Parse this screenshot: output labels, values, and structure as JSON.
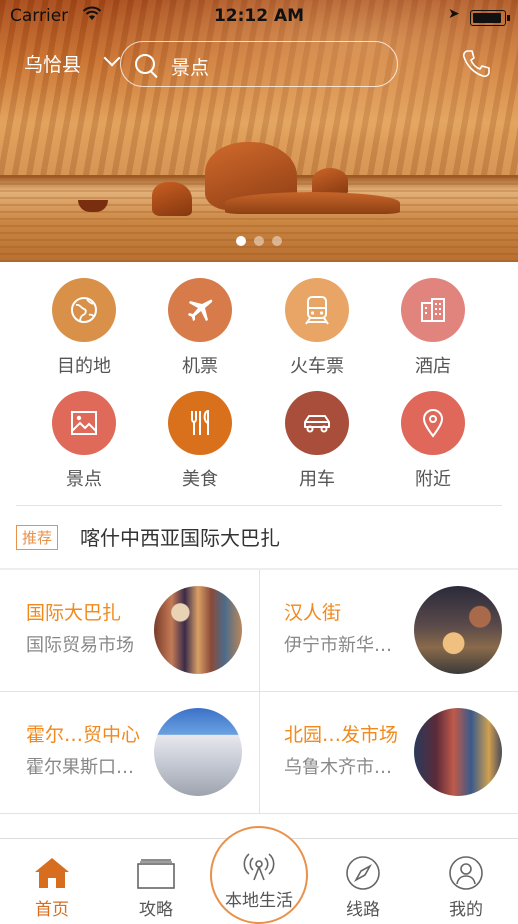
{
  "status_bar": {
    "carrier": "Carrier",
    "time": "12:12 AM"
  },
  "header": {
    "city": "乌恰县",
    "search_placeholder": "景点"
  },
  "banner": {
    "page_count": 3,
    "active_page": 1
  },
  "categories": [
    {
      "label": "目的地",
      "icon": "globe-icon",
      "color": "#d99149"
    },
    {
      "label": "机票",
      "icon": "airplane-icon",
      "color": "#d77b4a"
    },
    {
      "label": "火车票",
      "icon": "train-icon",
      "color": "#e8a565"
    },
    {
      "label": "酒店",
      "icon": "hotel-icon",
      "color": "#e2847e"
    },
    {
      "label": "景点",
      "icon": "picture-icon",
      "color": "#e06a5a"
    },
    {
      "label": "美食",
      "icon": "cutlery-icon",
      "color": "#d9701c"
    },
    {
      "label": "用车",
      "icon": "car-icon",
      "color": "#a84e3a"
    },
    {
      "label": "附近",
      "icon": "location-pin-icon",
      "color": "#e0685a"
    }
  ],
  "recommend": {
    "tag": "推荐",
    "text": "喀什中西亚国际大巴扎"
  },
  "places": [
    {
      "title": "国际大巴扎",
      "subtitle": "国际贸易市场"
    },
    {
      "title": "汉人街",
      "subtitle": "伊宁市新华…"
    },
    {
      "title": "霍尔…贸中心",
      "subtitle": "霍尔果斯口…"
    },
    {
      "title": "北园…发市场",
      "subtitle": "乌鲁木齐市…"
    }
  ],
  "tabs": [
    {
      "label": "首页",
      "icon": "home-icon",
      "active": true
    },
    {
      "label": "攻略",
      "icon": "book-icon",
      "active": false
    },
    {
      "label": "本地生活",
      "icon": "broadcast-icon",
      "active": false
    },
    {
      "label": "线路",
      "icon": "compass-icon",
      "active": false
    },
    {
      "label": "我的",
      "icon": "user-icon",
      "active": false
    }
  ],
  "colors": {
    "accent": "#e8914b",
    "title_orange": "#f08a1e",
    "active_tab": "#d76e1f"
  }
}
